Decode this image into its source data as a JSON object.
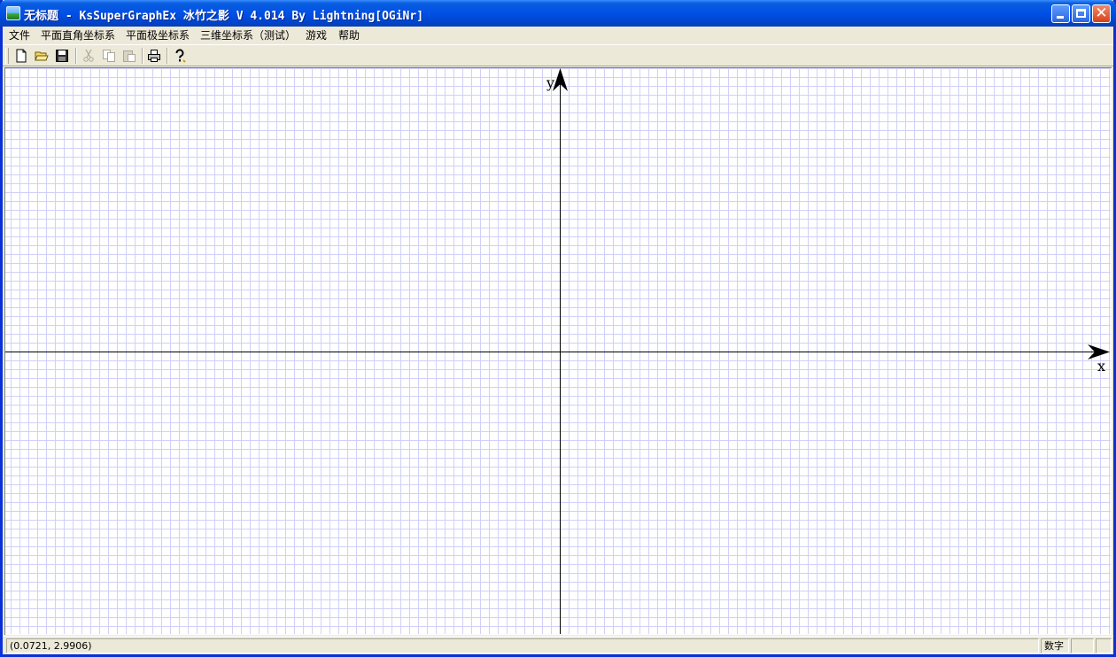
{
  "window": {
    "title": "无标题 - KsSuperGraphEx 冰竹之影 V 4.014 By Lightning[OGiNr]"
  },
  "menu": [
    "文件",
    "平面直角坐标系",
    "平面极坐标系",
    "三维坐标系（测试）",
    "游戏",
    "帮助"
  ],
  "toolbar": {
    "buttons": [
      {
        "name": "new-file-icon",
        "enabled": true
      },
      {
        "name": "open-folder-icon",
        "enabled": true
      },
      {
        "name": "save-icon",
        "enabled": true
      },
      {
        "name": "cut-icon",
        "enabled": false
      },
      {
        "name": "copy-icon",
        "enabled": false
      },
      {
        "name": "paste-icon",
        "enabled": false
      },
      {
        "name": "print-icon",
        "enabled": true
      },
      {
        "name": "help-icon",
        "enabled": true
      }
    ]
  },
  "graph": {
    "x_label": "x",
    "y_label": "y",
    "grid": true,
    "colors": {
      "grid": "#d0d0f8",
      "axis": "#000000",
      "background": "#ffffff"
    }
  },
  "status": {
    "coords": "(0.0721, 2.9906)",
    "mode": "数字"
  }
}
